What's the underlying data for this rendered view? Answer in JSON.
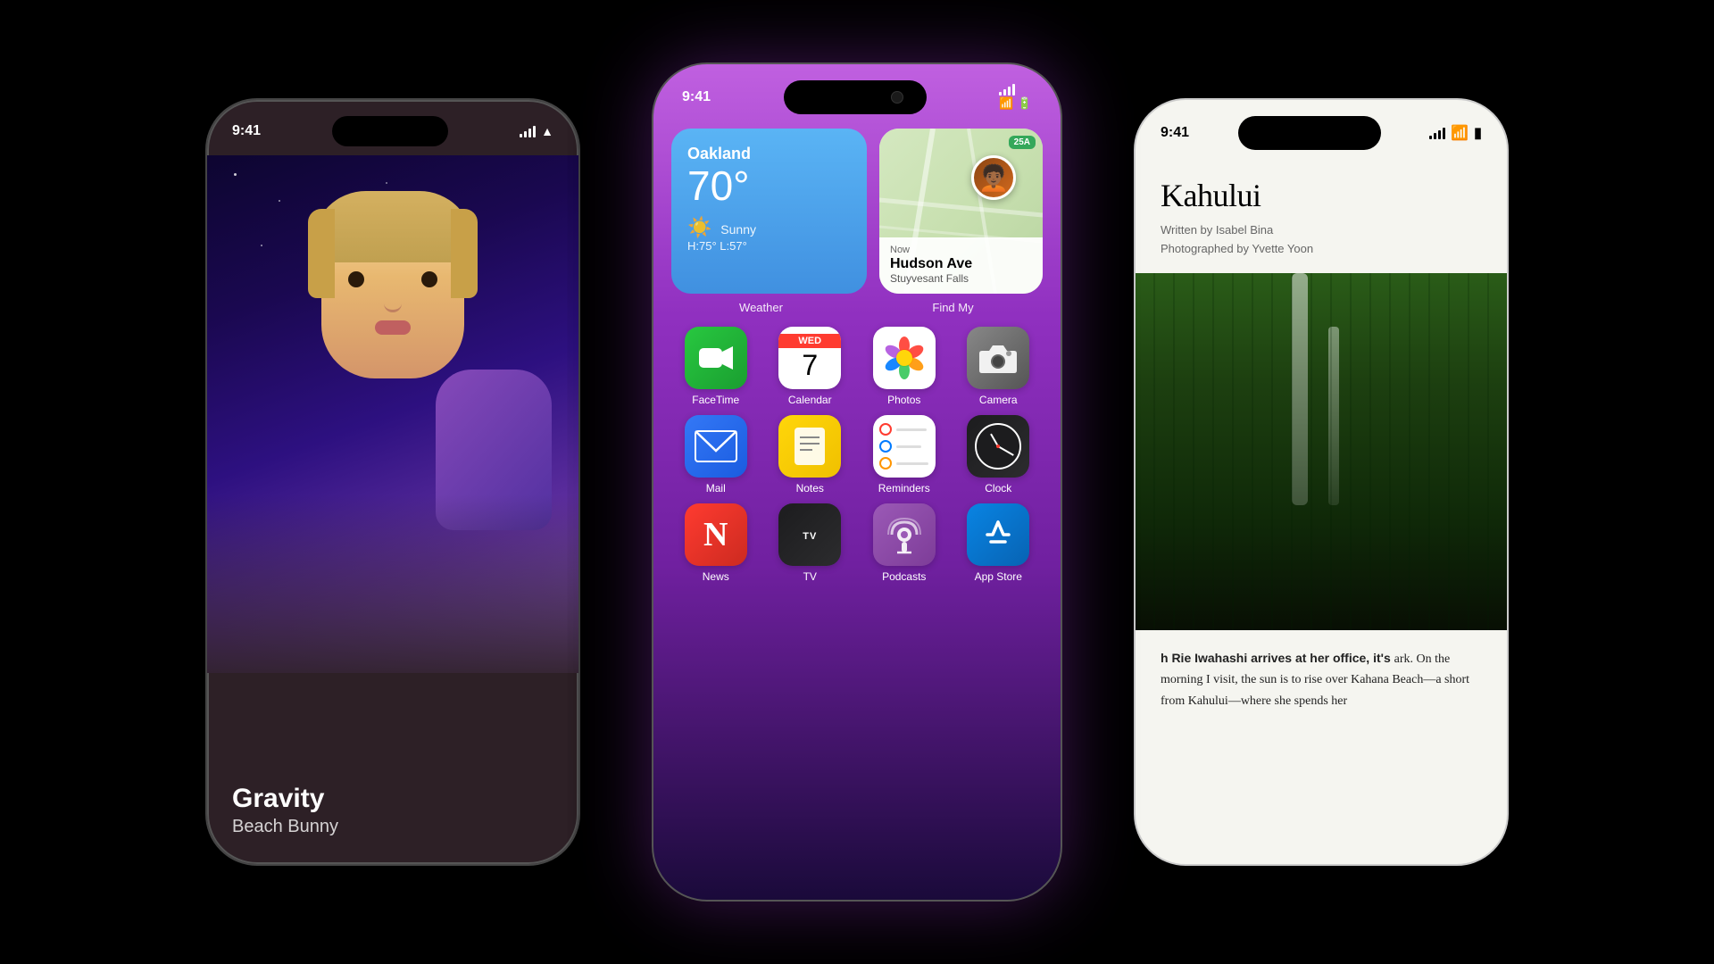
{
  "scene": {
    "background": "#000000"
  },
  "phone_left": {
    "time": "9:41",
    "song_title": "Gravity",
    "artist": "Beach Bunny"
  },
  "phone_center": {
    "time": "9:41",
    "widget_weather": {
      "city": "Oakland",
      "temperature": "70°",
      "condition": "Sunny",
      "high": "H:75°",
      "low": "L:57°",
      "label": "Weather"
    },
    "widget_findmy": {
      "label": "Find My",
      "now_text": "Now",
      "street": "Hudson Ave",
      "city": "Stuyvesant Falls",
      "route_badge": "25A"
    },
    "apps": [
      {
        "name": "FaceTime",
        "type": "facetime"
      },
      {
        "name": "Calendar",
        "type": "calendar",
        "day_abbr": "WED",
        "day_num": "7"
      },
      {
        "name": "Photos",
        "type": "photos"
      },
      {
        "name": "Camera",
        "type": "camera"
      },
      {
        "name": "Mail",
        "type": "mail"
      },
      {
        "name": "Notes",
        "type": "notes"
      },
      {
        "name": "Reminders",
        "type": "reminders"
      },
      {
        "name": "Clock",
        "type": "clock"
      },
      {
        "name": "News",
        "type": "news"
      },
      {
        "name": "TV",
        "type": "tv"
      },
      {
        "name": "Podcasts",
        "type": "podcasts"
      },
      {
        "name": "App Store",
        "type": "appstore"
      }
    ]
  },
  "phone_right": {
    "time": "9:41",
    "article": {
      "title": "Kahului",
      "written_by": "Written by Isabel Bina",
      "photographed_by": "Photographed by Yvette Yoon",
      "body": "h Rie Iwahashi arrives at her office, it's ark. On the morning I visit, the sun is to rise over Kahana Beach—a short from Kahului—where she spends her"
    }
  }
}
